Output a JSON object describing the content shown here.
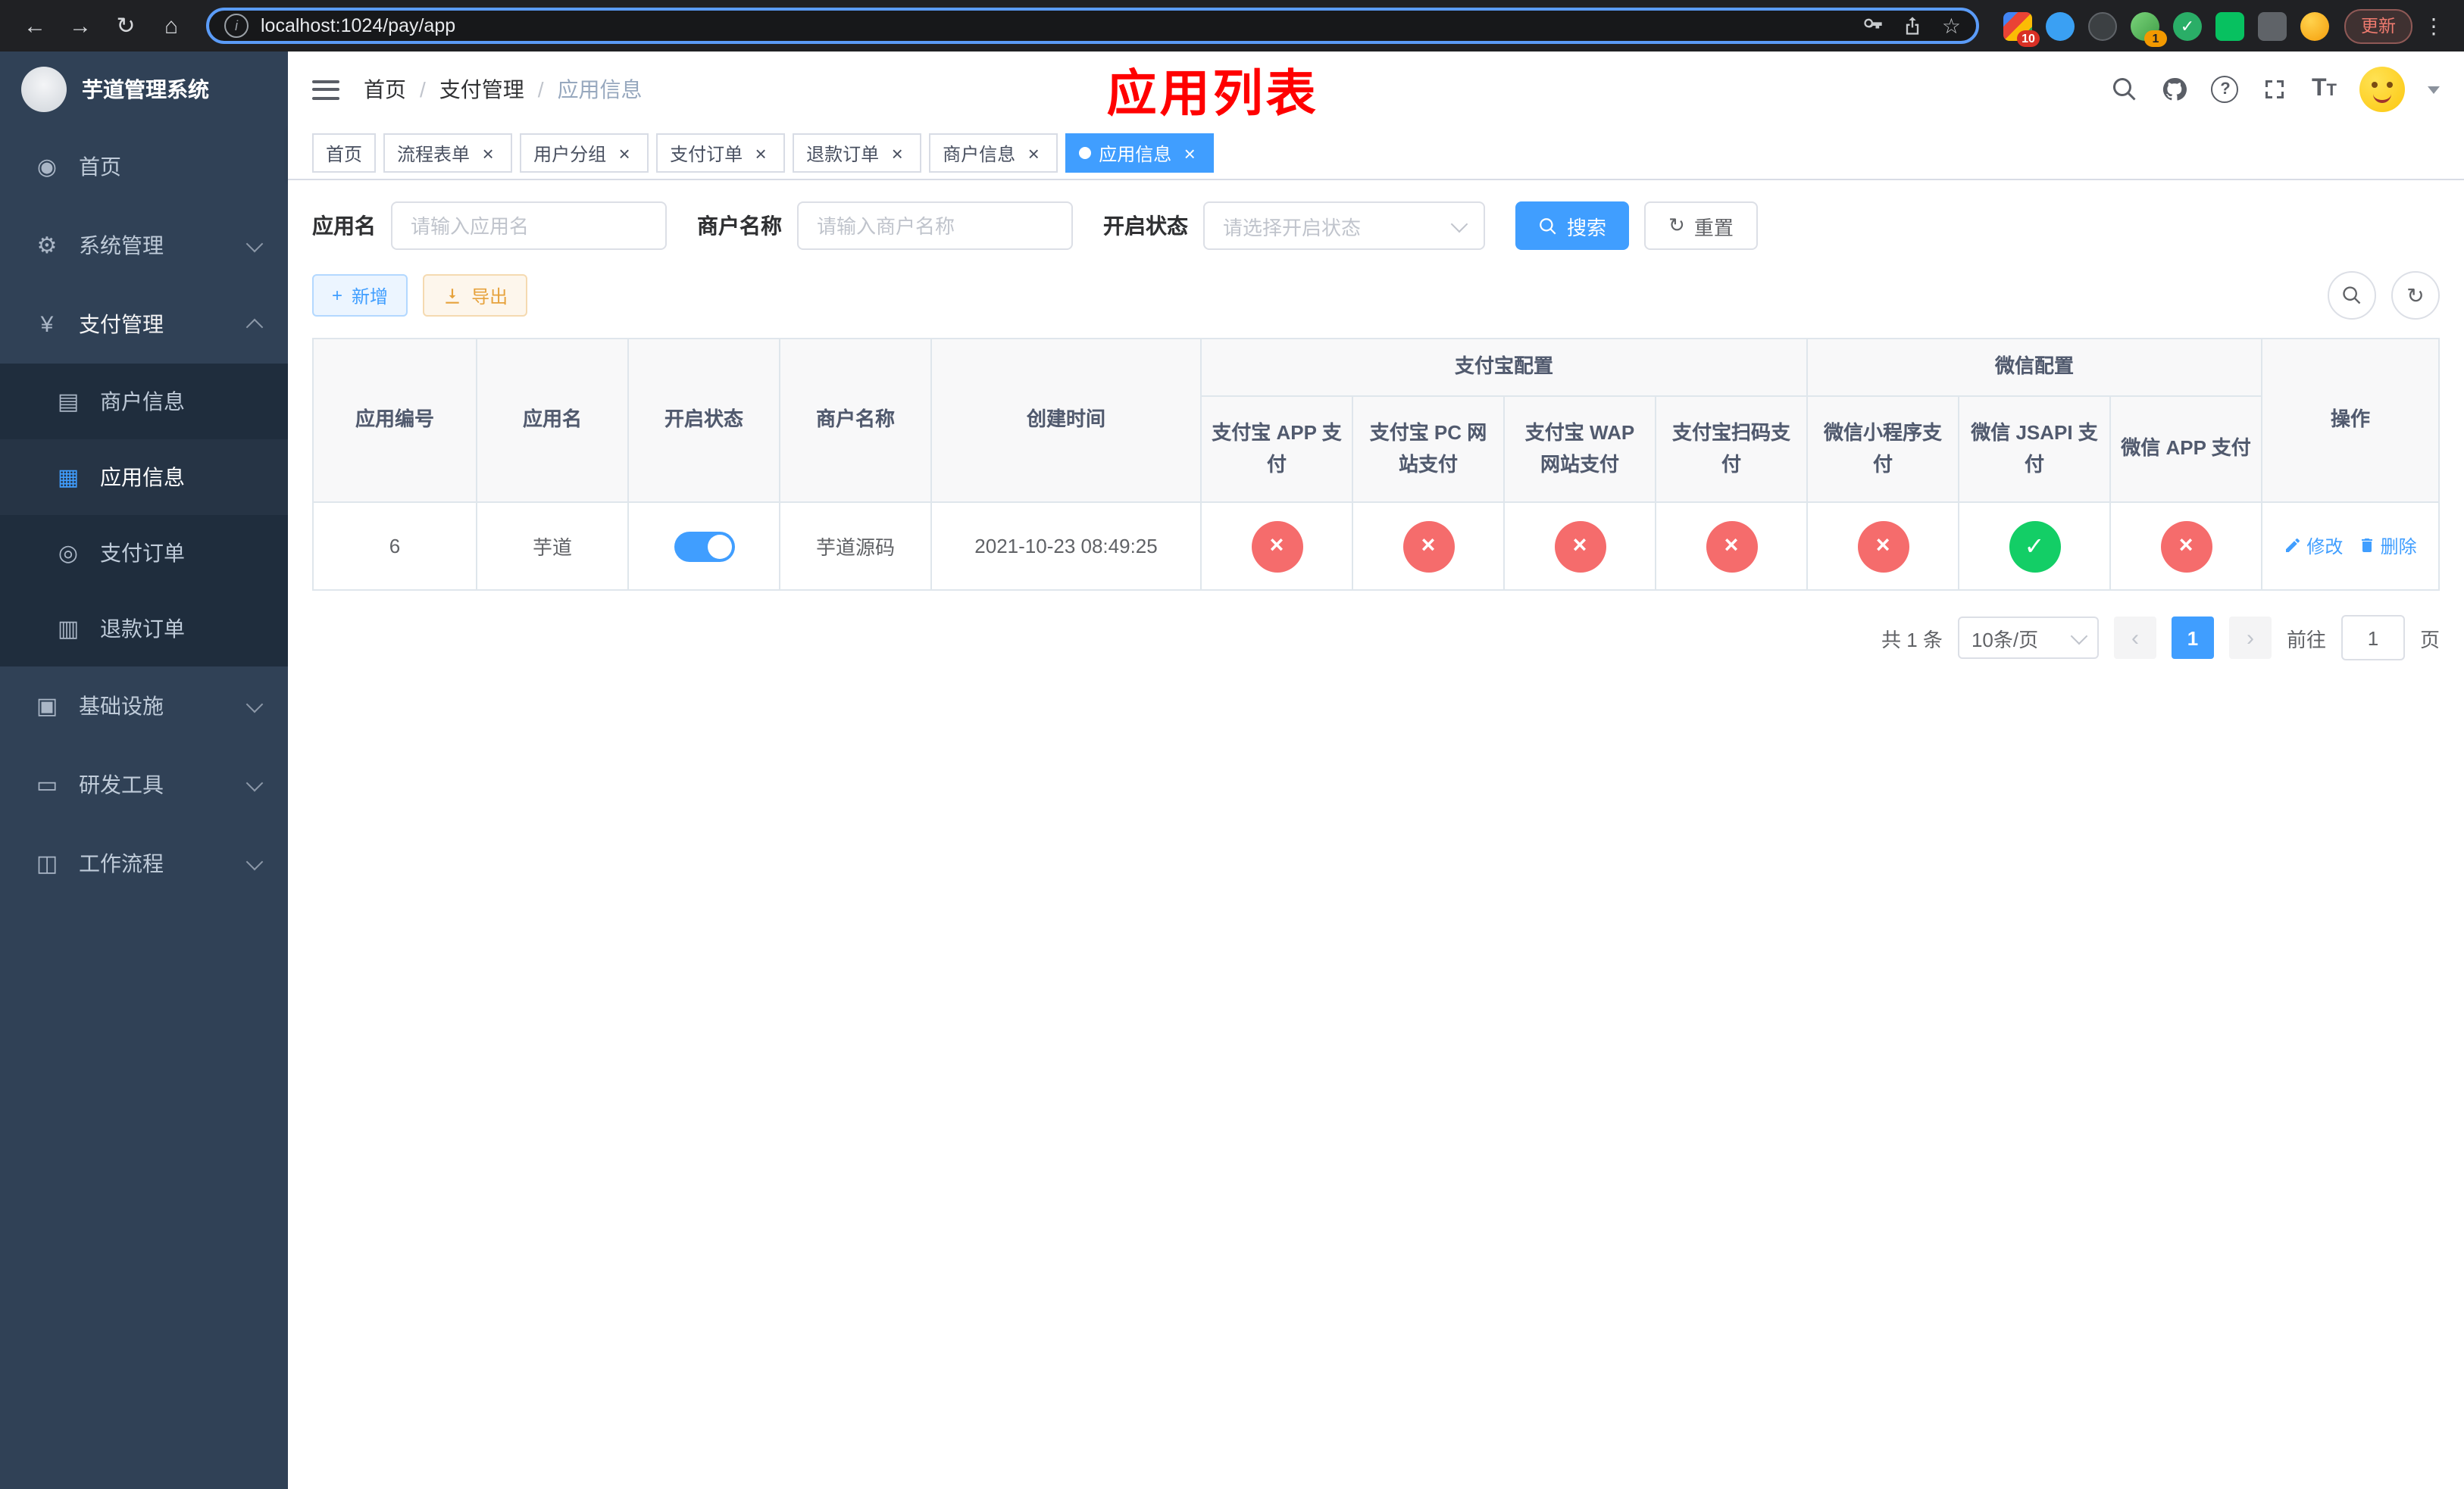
{
  "browser": {
    "url": "localhost:1024/pay/app",
    "update_label": "更新",
    "badges": {
      "extensions": "10",
      "profile": "1"
    }
  },
  "glyphs": {
    "back": "←",
    "forward": "→",
    "reload": "↻",
    "home": "⌂",
    "star": "☆",
    "info": "i",
    "more": "⋮",
    "check": "✓",
    "plus": "+",
    "refresh": "↻"
  },
  "sidebar": {
    "title": "芋道管理系统",
    "items": [
      {
        "label": "首页",
        "icon": "◉"
      },
      {
        "label": "系统管理",
        "icon": "⚙"
      },
      {
        "label": "支付管理",
        "icon": "¥",
        "children": [
          {
            "label": "商户信息",
            "icon": "▤"
          },
          {
            "label": "应用信息",
            "icon": "▦"
          },
          {
            "label": "支付订单",
            "icon": "◎"
          },
          {
            "label": "退款订单",
            "icon": "▥"
          }
        ]
      },
      {
        "label": "基础设施",
        "icon": "▣"
      },
      {
        "label": "研发工具",
        "icon": "▭"
      },
      {
        "label": "工作流程",
        "icon": "◫"
      }
    ]
  },
  "navbar": {
    "breadcrumb": [
      "首页",
      "支付管理",
      "应用信息"
    ],
    "separator": "/",
    "annotation": "应用列表",
    "help_glyph": "?",
    "fontsize_big": "T",
    "fontsize_small": "T"
  },
  "tabs": [
    {
      "label": "首页"
    },
    {
      "label": "流程表单",
      "close": "×"
    },
    {
      "label": "用户分组",
      "close": "×"
    },
    {
      "label": "支付订单",
      "close": "×"
    },
    {
      "label": "退款订单",
      "close": "×"
    },
    {
      "label": "商户信息",
      "close": "×"
    },
    {
      "label": "应用信息",
      "close": "×",
      "active": true
    }
  ],
  "filters": {
    "app_name_label": "应用名",
    "app_name_placeholder": "请输入应用名",
    "merchant_label": "商户名称",
    "merchant_placeholder": "请输入商户名称",
    "status_label": "开启状态",
    "status_placeholder": "请选择开启状态",
    "search_label": "搜索",
    "reset_label": "重置"
  },
  "toolbar": {
    "add_label": "新增",
    "export_label": "导出"
  },
  "table": {
    "group_headers": {
      "alipay": "支付宝配置",
      "wechat": "微信配置"
    },
    "columns": [
      "应用编号",
      "应用名",
      "开启状态",
      "商户名称",
      "创建时间",
      "支付宝 APP 支付",
      "支付宝 PC 网站支付",
      "支付宝 WAP 网站支付",
      "支付宝扫码支付",
      "微信小程序支付",
      "微信 JSAPI 支付",
      "微信 APP 支付",
      "操作"
    ],
    "rows": [
      {
        "id": "6",
        "name": "芋道",
        "enabled": true,
        "merchant": "芋道源码",
        "created": "2021-10-23 08:49:25",
        "channels": [
          false,
          false,
          false,
          false,
          false,
          true,
          false
        ],
        "edit_label": "修改",
        "delete_label": "删除"
      }
    ]
  },
  "pagination": {
    "total_text": "共 1 条",
    "page_size": "10条/页",
    "prev": "‹",
    "next": "›",
    "page": "1",
    "goto_label": "前往",
    "goto_value": "1",
    "goto_unit": "页"
  }
}
